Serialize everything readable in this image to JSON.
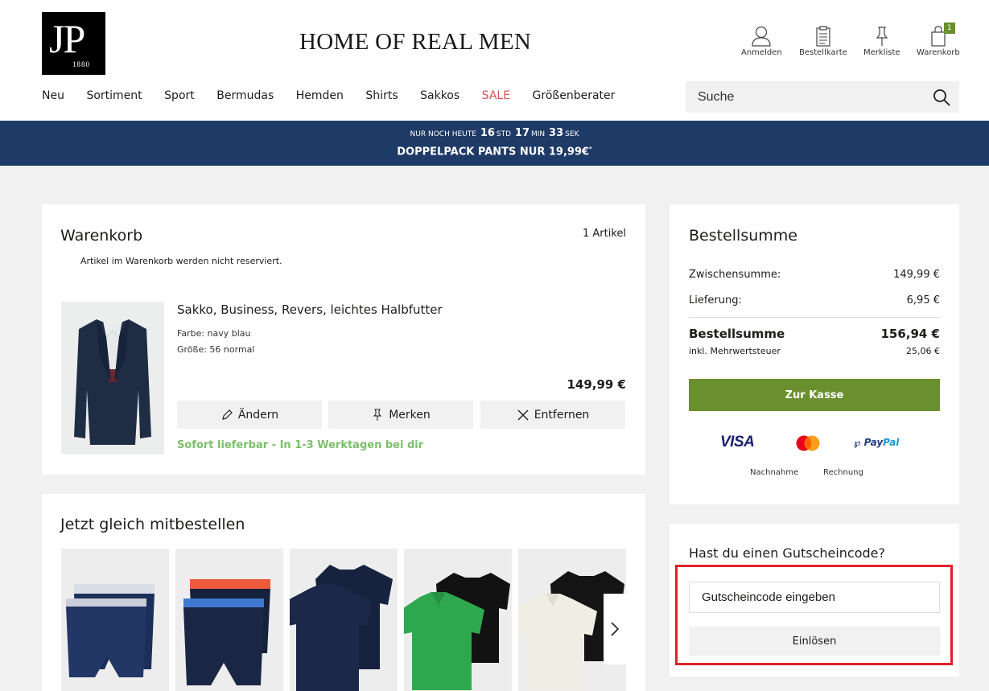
{
  "header": {
    "logo": {
      "letters": "JP",
      "year": "1880"
    },
    "tagline": "HOME OF REAL MEN",
    "utilities": [
      {
        "icon": "user-icon",
        "label": "Anmelden"
      },
      {
        "icon": "clipboard-icon",
        "label": "Bestellkarte"
      },
      {
        "icon": "pin-icon",
        "label": "Merkliste"
      },
      {
        "icon": "shopping-bag-icon",
        "label": "Warenkorb",
        "badge": "1"
      }
    ],
    "nav": [
      "Neu",
      "Sortiment",
      "Sport",
      "Bermudas",
      "Hemden",
      "Shirts",
      "Sakkos",
      "SALE",
      "Größenberater"
    ],
    "search": {
      "placeholder": "Suche"
    }
  },
  "promo": {
    "prefix": "NUR NOCH HEUTE",
    "hours": "16",
    "hours_unit": "STD",
    "minutes": "17",
    "minutes_unit": "MIN",
    "seconds": "33",
    "seconds_unit": "SEK",
    "headline": "DOPPELPACK PANTS NUR 19,99€",
    "footnote_mark": "*"
  },
  "cart": {
    "title": "Warenkorb",
    "count": "1 Artikel",
    "note": "Artikel im Warenkorb werden nicht reserviert.",
    "item": {
      "name": "Sakko, Business, Revers, leichtes Halbfutter",
      "color": "Farbe: navy blau",
      "size": "Größe: 56 normal",
      "price": "149,99 €",
      "actions": {
        "edit": "Ändern",
        "save": "Merken",
        "remove": "Entfernen"
      },
      "availability": "Sofort lieferbar - In 1-3 Werktagen bei dir"
    }
  },
  "summary": {
    "title": "Bestellsumme",
    "subtotal_label": "Zwischensumme:",
    "subtotal": "149,99 €",
    "shipping_label": "Lieferung:",
    "shipping": "6,95 €",
    "total_label": "Bestellsumme",
    "total": "156,94 €",
    "vat_label": "inkl. Mehrwertsteuer",
    "vat": "25,06 €",
    "checkout": "Zur Kasse",
    "payments": {
      "visa": "VISA",
      "paypal_a": "Pay",
      "paypal_b": "Pal",
      "cod": "Nachnahme",
      "invoice": "Rechnung"
    }
  },
  "voucher": {
    "title": "Hast du einen Gutscheincode?",
    "placeholder": "Gutscheincode eingeben",
    "button": "Einlösen"
  },
  "recommendations": {
    "title": "Jetzt gleich mitbestellen"
  },
  "colors": {
    "promo_bg": "#1e3a66",
    "checkout_green": "#6a8f2f",
    "availability_green": "#7bbf6a",
    "sale_red": "#d9534f",
    "highlight_red": "#e0202a"
  }
}
